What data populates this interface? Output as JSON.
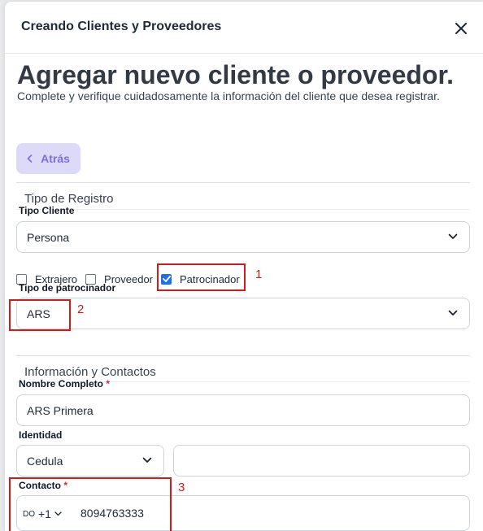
{
  "modal": {
    "title": "Creando Clientes y Proveedores",
    "close_icon": "close-icon"
  },
  "page": {
    "title": "Agregar nuevo cliente o proveedor.",
    "subtitle": "Complete y verifique cuidadosamente la información del cliente que desea registrar."
  },
  "back_button": {
    "label": "Atrás",
    "icon": "chevron-left-icon"
  },
  "registro": {
    "section_title": "Tipo de Registro",
    "tipo_cliente": {
      "label": "Tipo Cliente",
      "value": "Persona"
    },
    "checkboxes": [
      {
        "label": "Extrajero",
        "checked": false
      },
      {
        "label": "Proveedor",
        "checked": false
      },
      {
        "label": "Patrocinador",
        "checked": true
      }
    ],
    "tipo_patrocinador": {
      "label": "Tipo de patrocinador",
      "value": "ARS"
    }
  },
  "contactos": {
    "section_title": "Información y Contactos",
    "nombre": {
      "label": "Nombre Completo",
      "required": "*",
      "value": "ARS Primera"
    },
    "identidad": {
      "label": "Identidad",
      "type_value": "Cedula",
      "number_value": ""
    },
    "contacto": {
      "label": "Contacto",
      "required": "*",
      "country": "DO",
      "code": "+1",
      "value": "8094763333"
    }
  },
  "annotations": [
    "1",
    "2",
    "3"
  ],
  "colors": {
    "accent": "#7c6fe0",
    "accent_bg": "#ddd9f9",
    "annotation": "#d11a1a",
    "checkbox": "#1f6feb"
  }
}
